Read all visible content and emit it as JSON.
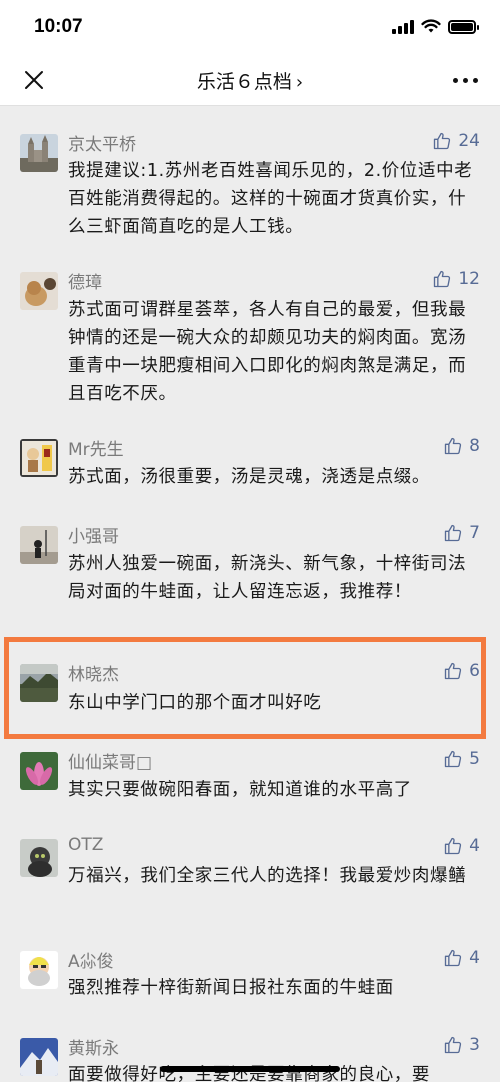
{
  "status": {
    "time": "10:07"
  },
  "nav": {
    "title": "乐活６点档",
    "chevron": "›"
  },
  "comments": [
    {
      "name": "京太平桥",
      "likes": "24",
      "avatar_icon": "church-photo-avatar",
      "text": "我提建议:1.苏州老百姓喜闻乐见的，2.价位适中老百姓能消费得起的。这样的十碗面才货真价实，什么三虾面简直吃的是人工钱。"
    },
    {
      "name": "德璋",
      "likes": "12",
      "avatar_icon": "dog-photo-avatar",
      "text": "苏式面可谓群星荟萃，各人有自己的最爱，但我最钟情的还是一碗大众的却颇见功夫的焖肉面。宽汤重青中一块肥瘦相间入口即化的焖肉煞是满足，而且百吃不厌。"
    },
    {
      "name": "Mr先生",
      "likes": "8",
      "avatar_icon": "cartoon-avatar",
      "text": "苏式面，汤很重要，汤是灵魂，浇透是点缀。"
    },
    {
      "name": "小强哥",
      "likes": "7",
      "avatar_icon": "silhouette-photo-avatar",
      "text": "苏州人独爱一碗面，新浇头、新气象，十梓街司法局对面的牛蛙面，让人留连忘返，我推荐！"
    },
    {
      "name": "林晓杰",
      "likes": "6",
      "avatar_icon": "landscape-photo-avatar",
      "text": "东山中学门口的那个面才叫好吃"
    },
    {
      "name": "仙仙菜哥□",
      "likes": "5",
      "avatar_icon": "lotus-photo-avatar",
      "text": "其实只要做碗阳春面，就知道谁的水平高了"
    },
    {
      "name": "OTZ",
      "likes": "4",
      "avatar_icon": "cat-photo-avatar",
      "text": "万福兴，我们全家三代人的选择！我最爱炒肉爆鳝"
    },
    {
      "name": "A尛俊",
      "likes": "4",
      "avatar_icon": "cartoon-old-man-avatar",
      "text": "强烈推荐十梓街新闻日报社东面的牛蛙面"
    },
    {
      "name": "黄斯永",
      "likes": "3",
      "avatar_icon": "mountain-photo-avatar",
      "text": "面要做得好吃，主要还是要靠商家的良心，要"
    }
  ],
  "colors": {
    "highlight": "#f37a3f",
    "link": "#576b95"
  }
}
